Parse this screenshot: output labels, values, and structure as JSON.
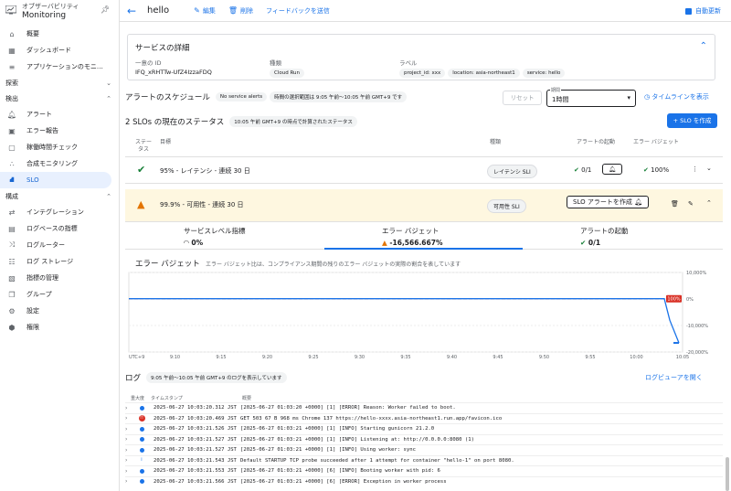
{
  "brand": {
    "line1": "オブザーバビリティ",
    "line2": "Monitoring"
  },
  "sidebar": {
    "top_items": [
      {
        "label": "概要",
        "icon": "home-icon"
      },
      {
        "label": "ダッシュボード",
        "icon": "dashboard-icon"
      },
      {
        "label": "アプリケーションのモニ…",
        "icon": "app-monitoring-icon"
      }
    ],
    "sections": [
      {
        "label": "探索",
        "items": []
      },
      {
        "label": "検出",
        "items": [
          {
            "label": "アラート",
            "icon": "bell-icon"
          },
          {
            "label": "エラー報告",
            "icon": "error-report-icon"
          },
          {
            "label": "稼働時間チェック",
            "icon": "uptime-icon"
          },
          {
            "label": "合成モニタリング",
            "icon": "synthetic-icon"
          },
          {
            "label": "SLO",
            "icon": "slo-icon",
            "active": true
          }
        ]
      },
      {
        "label": "構成",
        "items": [
          {
            "label": "インテグレーション",
            "icon": "integration-icon"
          },
          {
            "label": "ログベースの指標",
            "icon": "log-metrics-icon"
          },
          {
            "label": "ログルーター",
            "icon": "log-router-icon"
          },
          {
            "label": "ログ ストレージ",
            "icon": "log-storage-icon"
          },
          {
            "label": "指標の管理",
            "icon": "metrics-management-icon"
          },
          {
            "label": "グループ",
            "icon": "groups-icon"
          },
          {
            "label": "設定",
            "icon": "settings-icon"
          },
          {
            "label": "権限",
            "icon": "permissions-icon"
          }
        ]
      }
    ]
  },
  "topbar": {
    "title": "hello",
    "edit": "編集",
    "delete": "削除",
    "feedback": "フィードバックを送信",
    "auto_refresh": "自動更新"
  },
  "details": {
    "title": "サービスの詳細",
    "id_label": "一意の ID",
    "id_value": "IFQ_xRHTTw-UfZ4IzzaFDQ",
    "type_label": "種類",
    "type_value": "Cloud Run",
    "labels_label": "ラベル",
    "labels": [
      "project_id: xxx",
      "location: asia-northeast1",
      "service: hello"
    ]
  },
  "schedule": {
    "title": "アラートのスケジュール",
    "no_alerts": "No service alerts",
    "range_chip": "時間の選択範囲は 9:05 午前〜10:05 午前 GMT+9 です",
    "reset": "リセット",
    "period_label": "期間",
    "period_value": "1時間",
    "timeline": "タイムラインを表示"
  },
  "slo_status": {
    "title": "2 SLOs の現在のステータス",
    "computed_chip": "10:05 午前 GMT+9 の時点で計算されたステータス",
    "create_button": "+ SLO を作成",
    "columns": {
      "status1": "ステー",
      "status2": "タス",
      "goal": "目標",
      "type": "種類",
      "alert": "アラートの起動",
      "budget": "エラー バジェット"
    }
  },
  "slos": [
    {
      "goal": "95% - レイテンシ - 連続 30 日",
      "type": "レイテンシ SLI",
      "alert": "0/1",
      "budget": "100%"
    },
    {
      "goal": "99.9% - 可用性 - 連続 30 日",
      "type": "可用性 SLI",
      "create_alert": "SLO アラートを作成"
    }
  ],
  "metrics": {
    "sli_label": "サービスレベル指標",
    "sli_value": "0%",
    "budget_label": "エラー バジェット",
    "budget_value": "-16,566.667%",
    "alert_label": "アラートの起動",
    "alert_value": "0/1"
  },
  "error_budget": {
    "title": "エラー バジェット",
    "desc": "エラー バジェット比は、コンプライアンス期間の残りのエラー バジェットの実際の割合を表しています"
  },
  "chart_data": {
    "type": "line",
    "title": "エラー バジェット",
    "x": [
      "UTC+9",
      "9:10",
      "9:15",
      "9:20",
      "9:25",
      "9:30",
      "9:35",
      "9:40",
      "9:45",
      "9:50",
      "9:55",
      "10:00",
      "10:05"
    ],
    "y_ticks": [
      "10,000%",
      "0%",
      "-10,000%",
      "-20,000%"
    ],
    "ylim": [
      -20000,
      10000
    ],
    "threshold_label": "100%",
    "threshold": 100,
    "series": [
      {
        "values": [
          100,
          100,
          100,
          100,
          100,
          100,
          100,
          100,
          100,
          100,
          100,
          100,
          -8000,
          -16566.667
        ]
      }
    ]
  },
  "logs": {
    "title": "ログ",
    "range_chip": "9:05 午前〜10:05 午前 GMT+9 のログを表示しています",
    "open": "ログビューアを開く",
    "col_severity": "重大度",
    "col_timestamp": "タイムスタンプ",
    "col_summary": "概要",
    "rows": [
      {
        "sev": "info",
        "ts": "2025-06-27 10:03:20.312 JST",
        "msg": "[2025-06-27 01:03:20 +0000] [1] [ERROR] Reason: Worker failed to boot."
      },
      {
        "sev": "error",
        "ts": "2025-06-27 10:03:20.469 JST",
        "msg": "GET  503  67 B  968 ms  Chrome 137   https://hello-xxxx.asia-northeast1.run.app/favicon.ico"
      },
      {
        "sev": "info",
        "ts": "2025-06-27 10:03:21.526 JST",
        "msg": "[2025-06-27 01:03:21 +0000] [1] [INFO] Starting gunicorn 21.2.0"
      },
      {
        "sev": "info",
        "ts": "2025-06-27 10:03:21.527 JST",
        "msg": "[2025-06-27 01:03:21 +0000] [1] [INFO] Listening at: http://0.0.0.0:8080 (1)"
      },
      {
        "sev": "info",
        "ts": "2025-06-27 10:03:21.527 JST",
        "msg": "[2025-06-27 01:03:21 +0000] [1] [INFO] Using worker: sync"
      },
      {
        "sev": "notice",
        "ts": "2025-06-27 10:03:21.543 JST",
        "msg": "Default STARTUP TCP probe succeeded after 1 attempt for container \"hello-1\" on port 8080."
      },
      {
        "sev": "info",
        "ts": "2025-06-27 10:03:21.553 JST",
        "msg": "[2025-06-27 01:03:21 +0000] [6] [INFO] Booting worker with pid: 6"
      },
      {
        "sev": "info",
        "ts": "2025-06-27 10:03:21.566 JST",
        "msg": "[2025-06-27 01:03:21 +0000] [6] [ERROR] Exception in worker process"
      }
    ]
  },
  "colors": {
    "accent": "#1a73e8",
    "ok": "#188038",
    "warn": "#e37400",
    "threshold": "#d93025",
    "warn_bg": "#fef7e0"
  }
}
